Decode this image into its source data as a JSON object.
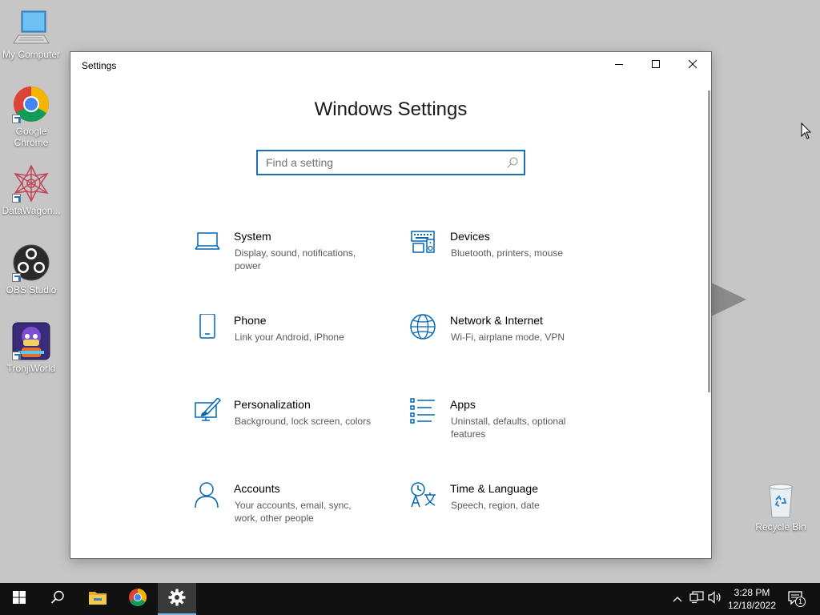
{
  "desktop": {
    "icons": [
      {
        "label": "My Computer",
        "icon": "monitor-icon"
      },
      {
        "label": "Google Chrome",
        "icon": "chrome-icon"
      },
      {
        "label": "DataWagon...",
        "icon": "datawagon-icon"
      },
      {
        "label": "OBS Studio",
        "icon": "obs-icon"
      },
      {
        "label": "TronjiWorld",
        "icon": "tronjiworld-icon"
      },
      {
        "label": "Recycle Bin",
        "icon": "recycle-bin-icon"
      }
    ]
  },
  "window": {
    "title": "Settings",
    "controls": {
      "minimize": "minimize-icon",
      "maximize": "maximize-icon",
      "close": "close-icon"
    },
    "heading": "Windows Settings",
    "search": {
      "placeholder": "Find a setting",
      "value": "",
      "icon": "search-icon"
    },
    "categories": [
      {
        "name": "System",
        "description": "Display, sound, notifications, power",
        "icon": "laptop-icon"
      },
      {
        "name": "Devices",
        "description": "Bluetooth, printers, mouse",
        "icon": "keyboard-speaker-icon"
      },
      {
        "name": "Phone",
        "description": "Link your Android, iPhone",
        "icon": "phone-icon"
      },
      {
        "name": "Network & Internet",
        "description": "Wi-Fi, airplane mode, VPN",
        "icon": "globe-icon"
      },
      {
        "name": "Personalization",
        "description": "Background, lock screen, colors",
        "icon": "paint-brush-icon"
      },
      {
        "name": "Apps",
        "description": "Uninstall, defaults, optional features",
        "icon": "apps-list-icon"
      },
      {
        "name": "Accounts",
        "description": "Your accounts, email, sync, work, other people",
        "icon": "person-icon"
      },
      {
        "name": "Time & Language",
        "description": "Speech, region, date",
        "icon": "time-language-icon"
      }
    ]
  },
  "taskbar": {
    "buttons": [
      "start-icon",
      "search-icon",
      "file-explorer-icon",
      "chrome-icon",
      "settings-gear-icon"
    ],
    "active": "settings-gear-icon",
    "tray": [
      "chevron-up-icon",
      "network-icon",
      "volume-icon"
    ],
    "time": "3:28 PM",
    "date": "12/18/2022",
    "notifications": {
      "icon": "action-center-icon",
      "count": "1"
    }
  },
  "colors": {
    "accent": "#0067b8",
    "desktop_bg": "#c6c6c6",
    "taskbar_bg": "#111111"
  }
}
